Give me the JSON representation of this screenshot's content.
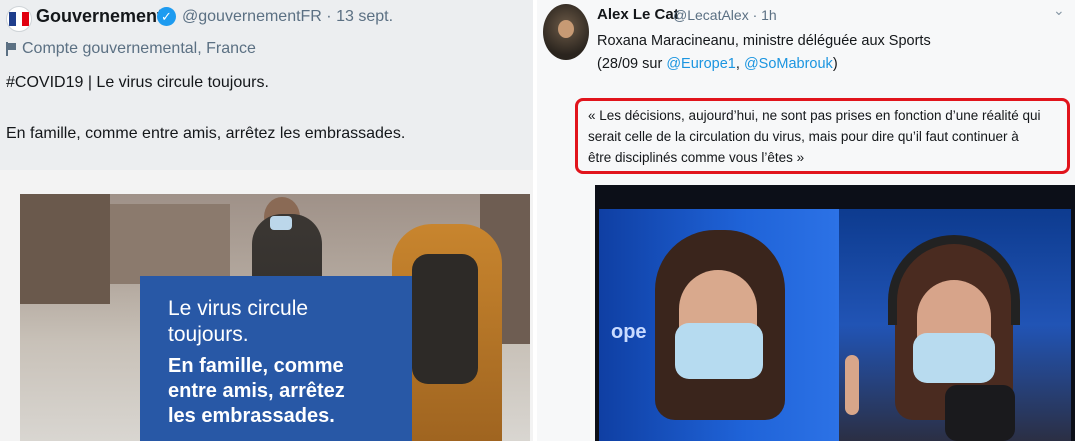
{
  "left_tweet": {
    "name": "Gouvernement",
    "handle_time": "@gouvernementFR · 13 sept.",
    "account_label": "Compte gouvernemental, France",
    "text_line1": "#COVID19 | Le virus circule toujours.",
    "text_line2": "En famille, comme entre amis, arrêtez les embrassades.",
    "image": {
      "overlay_line1": "Le virus circule",
      "overlay_line2": "toujours.",
      "overlay_bold1": "En famille, comme",
      "overlay_bold2": "entre amis, arrêtez",
      "overlay_bold3": "les embrassades."
    },
    "icons": [
      "french-flag-icon",
      "verified-badge-icon",
      "flag-icon"
    ]
  },
  "right_tweet": {
    "name": "Alex Le Cat",
    "handle_time": "@LecatAlex · 1h",
    "line1": "Roxana Maracineanu, ministre déléguée aux Sports",
    "line2_prefix": "(28/09 sur ",
    "mention1": "@Europe1",
    "line2_sep": ", ",
    "mention2": "@SoMabrouk",
    "line2_suffix": ")",
    "quote_lines": [
      "« Les décisions, aujourd’hui, ne sont pas prises en fonction d’une réalité qui",
      "serait celle de la circulation du virus, mais pour dire qu’il faut continuer à",
      "être disciplinés comme vous l’êtes »"
    ],
    "video_text": "ope",
    "icons": [
      "avatar",
      "chevron-down-icon"
    ]
  },
  "colors": {
    "highlight_border": "#e1141c",
    "mention": "#1b95e0",
    "overlay_blue": "#2858a6",
    "verified": "#1d9bf0"
  }
}
